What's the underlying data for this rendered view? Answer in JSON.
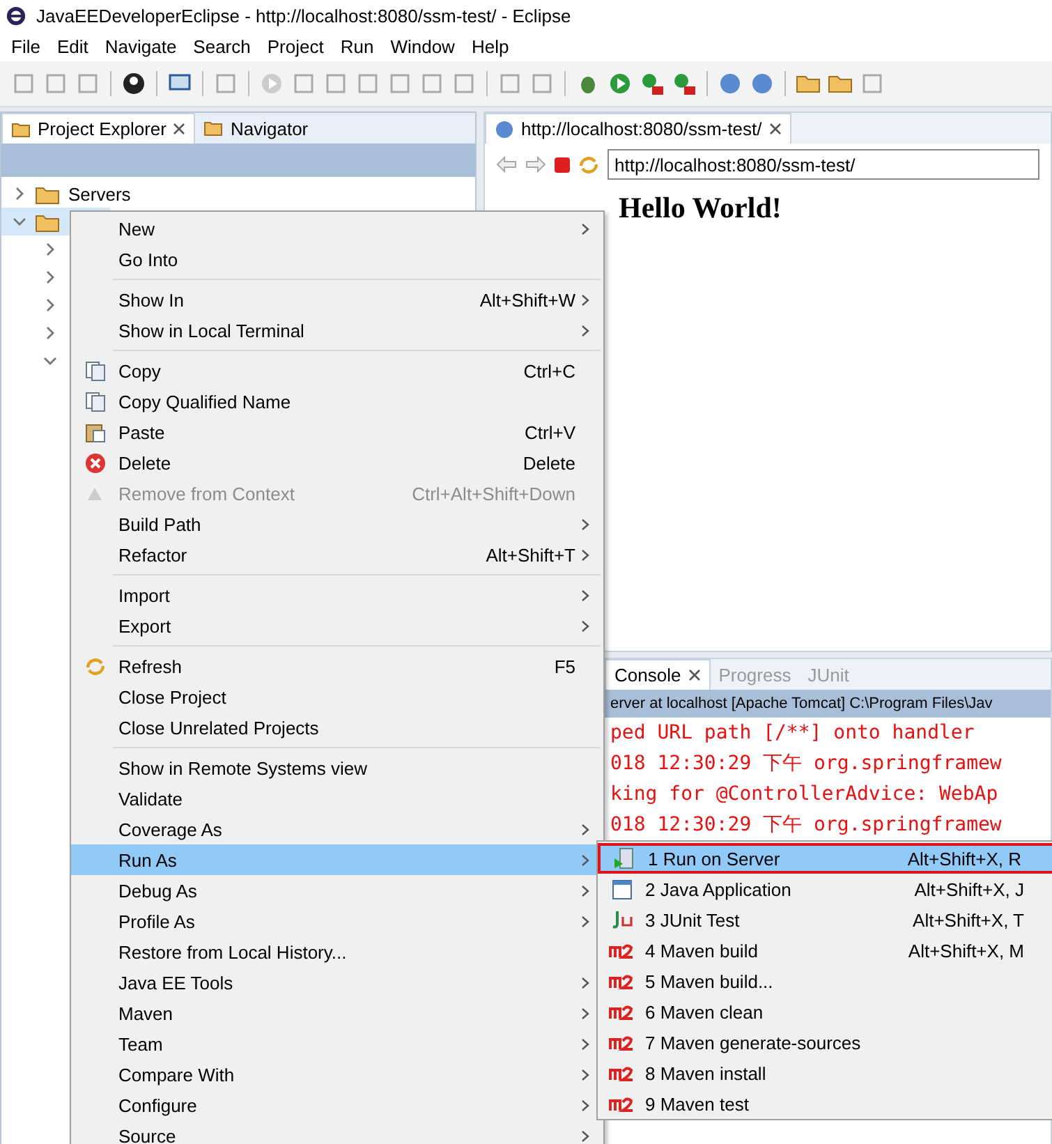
{
  "window": {
    "title": "JavaEEDeveloperEclipse - http://localhost:8080/ssm-test/ - Eclipse"
  },
  "menubar": [
    "File",
    "Edit",
    "Navigate",
    "Search",
    "Project",
    "Run",
    "Window",
    "Help"
  ],
  "explorer": {
    "tabs": [
      {
        "label": "Project Explorer",
        "selected": true
      },
      {
        "label": "Navigator",
        "selected": false
      }
    ],
    "tree": [
      {
        "label": "Servers",
        "expanded": false,
        "selected": false
      },
      {
        "expanded": true,
        "selected": true,
        "children": [
          {
            "expanded": false
          },
          {
            "expanded": false
          },
          {
            "expanded": false
          },
          {
            "expanded": false
          },
          {
            "expanded": true
          }
        ]
      }
    ]
  },
  "browser": {
    "tab": "http://localhost:8080/ssm-test/",
    "url": "http://localhost:8080/ssm-test/",
    "heading": "Hello World!"
  },
  "console": {
    "tabs": [
      {
        "label": "Console",
        "selected": true
      },
      {
        "label": "Progress",
        "selected": false
      },
      {
        "label": "JUnit",
        "selected": false
      }
    ],
    "header": "erver at localhost [Apache Tomcat] C:\\Program Files\\Jav",
    "lines": [
      "ped URL path [/**] onto handler",
      "018 12:30:29 下午 org.springframew",
      "king for @ControllerAdvice: WebAp",
      "018 12:30:29 下午 org.springframew"
    ]
  },
  "context_menu": [
    {
      "kind": "item",
      "label": "New",
      "submenu": true,
      "disabled": false,
      "selected": false
    },
    {
      "kind": "item",
      "label": "Go Into",
      "submenu": false,
      "disabled": false,
      "selected": false
    },
    {
      "kind": "separator"
    },
    {
      "kind": "item",
      "label": "Show In",
      "shortcut": "Alt+Shift+W",
      "submenu": true,
      "disabled": false,
      "selected": false
    },
    {
      "kind": "item",
      "label": "Show in Local Terminal",
      "submenu": true,
      "disabled": false,
      "selected": false
    },
    {
      "kind": "separator"
    },
    {
      "kind": "item",
      "label": "Copy",
      "shortcut": "Ctrl+C",
      "submenu": false,
      "disabled": false,
      "selected": false
    },
    {
      "kind": "item",
      "label": "Copy Qualified Name",
      "submenu": false,
      "disabled": false,
      "selected": false
    },
    {
      "kind": "item",
      "label": "Paste",
      "shortcut": "Ctrl+V",
      "submenu": false,
      "disabled": false,
      "selected": false
    },
    {
      "kind": "item",
      "label": "Delete",
      "shortcut": "Delete",
      "submenu": false,
      "disabled": false,
      "selected": false
    },
    {
      "kind": "item",
      "label": "Remove from Context",
      "shortcut": "Ctrl+Alt+Shift+Down",
      "submenu": false,
      "disabled": true,
      "selected": false
    },
    {
      "kind": "item",
      "label": "Build Path",
      "submenu": true,
      "disabled": false,
      "selected": false
    },
    {
      "kind": "item",
      "label": "Refactor",
      "shortcut": "Alt+Shift+T",
      "submenu": true,
      "disabled": false,
      "selected": false
    },
    {
      "kind": "separator"
    },
    {
      "kind": "item",
      "label": "Import",
      "submenu": true,
      "disabled": false,
      "selected": false
    },
    {
      "kind": "item",
      "label": "Export",
      "submenu": true,
      "disabled": false,
      "selected": false
    },
    {
      "kind": "separator"
    },
    {
      "kind": "item",
      "label": "Refresh",
      "shortcut": "F5",
      "submenu": false,
      "disabled": false,
      "selected": false
    },
    {
      "kind": "item",
      "label": "Close Project",
      "submenu": false,
      "disabled": false,
      "selected": false
    },
    {
      "kind": "item",
      "label": "Close Unrelated Projects",
      "submenu": false,
      "disabled": false,
      "selected": false
    },
    {
      "kind": "separator"
    },
    {
      "kind": "item",
      "label": "Show in Remote Systems view",
      "submenu": false,
      "disabled": false,
      "selected": false
    },
    {
      "kind": "item",
      "label": "Validate",
      "submenu": false,
      "disabled": false,
      "selected": false
    },
    {
      "kind": "item",
      "label": "Coverage As",
      "submenu": true,
      "disabled": false,
      "selected": false
    },
    {
      "kind": "item",
      "label": "Run As",
      "submenu": true,
      "disabled": false,
      "selected": true
    },
    {
      "kind": "item",
      "label": "Debug As",
      "submenu": true,
      "disabled": false,
      "selected": false
    },
    {
      "kind": "item",
      "label": "Profile As",
      "submenu": true,
      "disabled": false,
      "selected": false
    },
    {
      "kind": "item",
      "label": "Restore from Local History...",
      "submenu": false,
      "disabled": false,
      "selected": false
    },
    {
      "kind": "item",
      "label": "Java EE Tools",
      "submenu": true,
      "disabled": false,
      "selected": false
    },
    {
      "kind": "item",
      "label": "Maven",
      "submenu": true,
      "disabled": false,
      "selected": false
    },
    {
      "kind": "item",
      "label": "Team",
      "submenu": true,
      "disabled": false,
      "selected": false
    },
    {
      "kind": "item",
      "label": "Compare With",
      "submenu": true,
      "disabled": false,
      "selected": false
    },
    {
      "kind": "item",
      "label": "Configure",
      "submenu": true,
      "disabled": false,
      "selected": false
    },
    {
      "kind": "item",
      "label": "Source",
      "submenu": true,
      "disabled": false,
      "selected": false
    }
  ],
  "run_as_menu": [
    {
      "label": "1 Run on Server",
      "shortcut": "Alt+Shift+X, R",
      "selected": true,
      "outlined": true
    },
    {
      "label": "2 Java Application",
      "shortcut": "Alt+Shift+X, J",
      "selected": false,
      "outlined": false
    },
    {
      "label": "3 JUnit Test",
      "shortcut": "Alt+Shift+X, T",
      "selected": false,
      "outlined": false
    },
    {
      "label": "4 Maven build",
      "shortcut": "Alt+Shift+X, M",
      "selected": false,
      "outlined": false
    },
    {
      "label": "5 Maven build...",
      "selected": false,
      "outlined": false
    },
    {
      "label": "6 Maven clean",
      "selected": false,
      "outlined": false
    },
    {
      "label": "7 Maven generate-sources",
      "selected": false,
      "outlined": false
    },
    {
      "label": "8 Maven install",
      "selected": false,
      "outlined": false
    },
    {
      "label": "9 Maven test",
      "selected": false,
      "outlined": false
    }
  ]
}
